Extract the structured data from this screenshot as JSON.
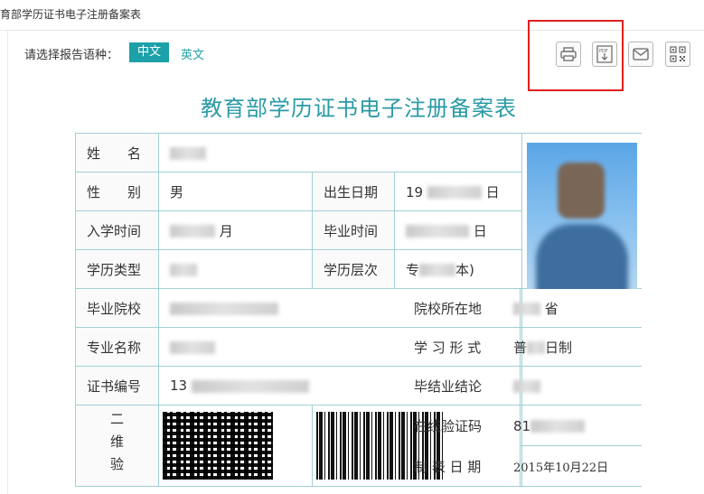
{
  "topbar": {
    "title": "育部学历证书电子注册备案表"
  },
  "language": {
    "label": "请选择报告语种：",
    "options": [
      "中文",
      "英文"
    ],
    "selected": "中文"
  },
  "toolbar": {
    "icons": [
      "print-icon",
      "pdf-download-icon",
      "mail-icon",
      "qrcode-icon"
    ]
  },
  "document": {
    "title": "教育部学历证书电子注册备案表"
  },
  "fields": {
    "name": "姓　　名",
    "gender": "性　　别",
    "birth_date": "出生日期",
    "enroll_time": "入学时间",
    "graduate_time": "毕业时间",
    "edu_type": "学历类型",
    "edu_level": "学历层次",
    "school": "毕业院校",
    "school_location": "院校所在地",
    "major": "专业名称",
    "study_form": "学 习 形 式",
    "cert_no": "证书编号",
    "conclusion": "毕结业结论",
    "qr_label": "二维验",
    "verify_code": "在线验证码",
    "make_date": "制 表 日 期"
  },
  "values": {
    "gender_partial": "男",
    "birth_partial": "19",
    "birth_suffix": "日",
    "enroll_suffix": "月",
    "graduate_suffix": "日",
    "edu_level_partial": "专",
    "edu_level_suffix": "本)",
    "location_suffix": "省",
    "study_form_partial": "普",
    "study_form_suffix": "日制",
    "cert_prefix": "13",
    "verify_prefix": "81",
    "make_date": "2015年10月22日"
  },
  "colors": {
    "accent": "#1da1a9",
    "title": "#2a9aa5",
    "border": "#9fd0d6",
    "highlight": "#e02020"
  }
}
